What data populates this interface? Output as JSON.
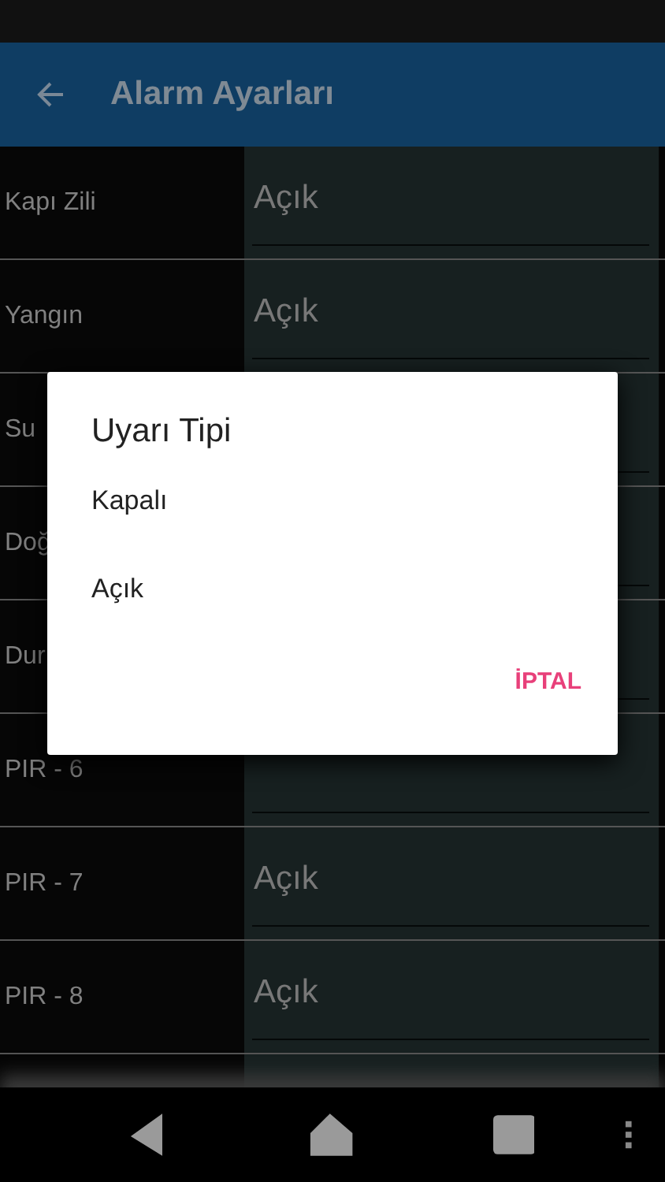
{
  "app_bar": {
    "title": "Alarm Ayarları"
  },
  "rows": [
    {
      "label": "Kapı Zili",
      "value": "Açık"
    },
    {
      "label": "Yangın",
      "value": "Açık"
    },
    {
      "label": "Su"
    },
    {
      "label": "Doğ"
    },
    {
      "label": "Dur"
    },
    {
      "label": "PIR - 6"
    },
    {
      "label": "PIR - 7",
      "value": "Açık"
    },
    {
      "label": "PIR - 8",
      "value": "Açık"
    },
    {}
  ],
  "dialog": {
    "title": "Uyarı Tipi",
    "options": [
      "Kapalı",
      "Açık"
    ],
    "buttons": [
      "İPTAL"
    ]
  }
}
